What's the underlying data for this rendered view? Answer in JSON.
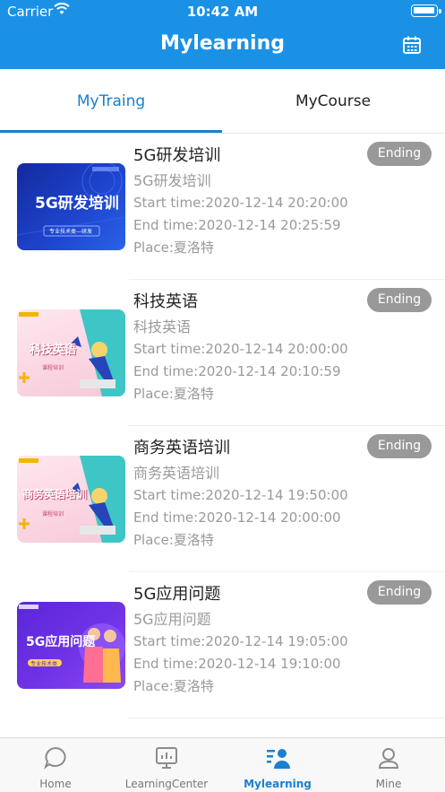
{
  "status": {
    "carrier": "Carrier",
    "time": "10:42 AM"
  },
  "header": {
    "title": "Mylearning",
    "action_icon": "calendar-icon"
  },
  "tabs": [
    {
      "label": "MyTraing",
      "active": true
    },
    {
      "label": "MyCourse",
      "active": false
    }
  ],
  "items": [
    {
      "name": "5G研发培训",
      "subtitle": "5G研发培训",
      "start": "Start time:2020-12-14 20:20:00",
      "end": "End time:2020-12-14 20:25:59",
      "place": "Place:夏洛特",
      "status": "Ending",
      "thumb_title": "5G研发培训",
      "thumb_sub": "专业技术类—研发"
    },
    {
      "name": "科技英语",
      "subtitle": "科技英语",
      "start": "Start time:2020-12-14 20:00:00",
      "end": "End time:2020-12-14 20:10:59",
      "place": "Place:夏洛特",
      "status": "Ending",
      "thumb_title": "科技英语",
      "thumb_sub": "课程培训"
    },
    {
      "name": "商务英语培训",
      "subtitle": "商务英语培训",
      "start": "Start time:2020-12-14 19:50:00",
      "end": "End time:2020-12-14 20:00:00",
      "place": "Place:夏洛特",
      "status": "Ending",
      "thumb_title": "商务英语培训",
      "thumb_sub": "课程培训"
    },
    {
      "name": "5G应用问题",
      "subtitle": "5G应用问题",
      "start": "Start time:2020-12-14 19:05:00",
      "end": "End time:2020-12-14 19:10:00",
      "place": "Place:夏洛特",
      "status": "Ending",
      "thumb_title": "5G应用问题",
      "thumb_sub": "专业技术类"
    }
  ],
  "bottom_tabs": [
    {
      "label": "Home",
      "icon": "chat-bubble-icon",
      "active": false
    },
    {
      "label": "LearningCenter",
      "icon": "presentation-board-icon",
      "active": false
    },
    {
      "label": "Mylearning",
      "icon": "people-list-icon",
      "active": true
    },
    {
      "label": "Mine",
      "icon": "user-profile-icon",
      "active": false
    }
  ],
  "colors": {
    "primary": "#1a91e5",
    "active_tab": "#1a7fd0",
    "badge": "#999999"
  }
}
